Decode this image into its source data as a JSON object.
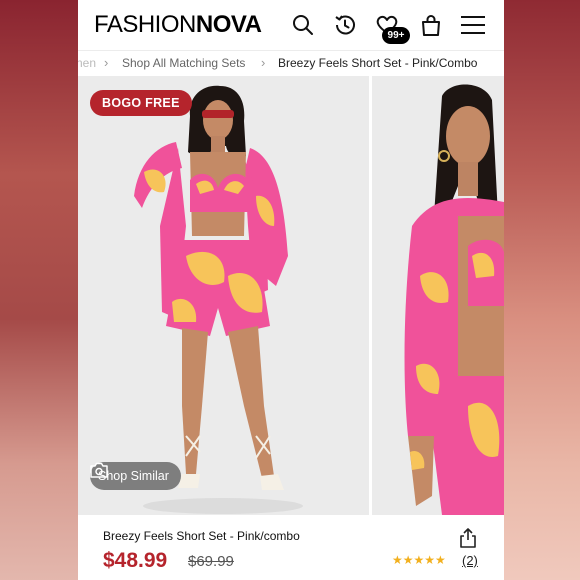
{
  "header": {
    "logo_fashion": "FASHION",
    "logo_nova": "NOVA",
    "wishlist_badge": "99+",
    "icons": [
      "search-icon",
      "history-icon",
      "heart-icon",
      "bag-icon",
      "menu-icon"
    ]
  },
  "breadcrumb": {
    "items": [
      "nen",
      "Shop All Matching Sets",
      "Breezy Feels Short Set - Pink/Combo"
    ]
  },
  "gallery": {
    "badge": "BOGO FREE",
    "shop_similar_label": "Shop Similar"
  },
  "product": {
    "name": "Breezy Feels Short Set - Pink/combo",
    "price": "$48.99",
    "original_price": "$69.99",
    "stars": "★★★★★",
    "rating": 5,
    "review_count": "(2)"
  },
  "colors": {
    "accent_red": "#b5242c",
    "star_gold": "#f2b01e",
    "print_pink": "#f0529a",
    "print_yellow": "#f7c45a"
  }
}
